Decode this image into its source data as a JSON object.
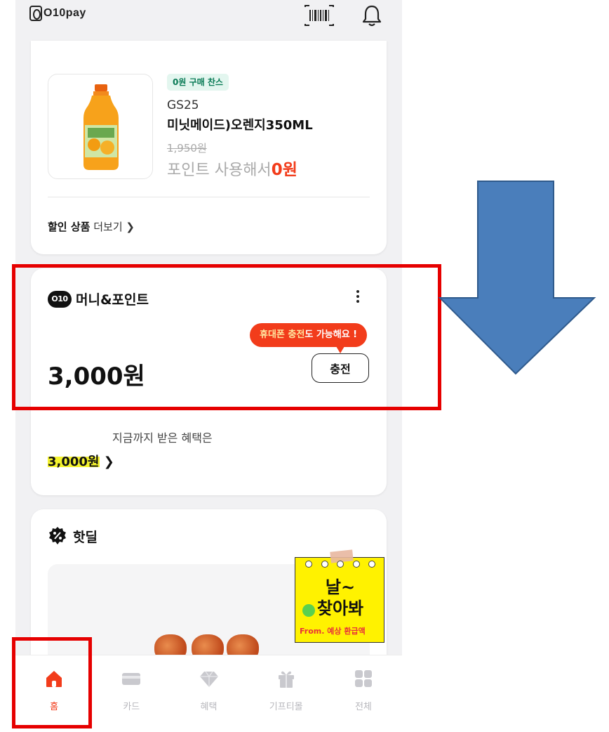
{
  "app": {
    "logo_text": "O10pay"
  },
  "header": {
    "barcode_icon": "barcode-icon",
    "bell_icon": "bell-icon"
  },
  "deal_card": {
    "badge": "0원 구매 찬스",
    "store": "GS25",
    "product_name": "미닛메이드)오렌지350ML",
    "original_price": "1,950원",
    "point_text": "포인트 사용해서",
    "point_price": "0원",
    "more_bold": "할인 상품",
    "more_rest": "더보기 ❯"
  },
  "money_card": {
    "logo": "O10",
    "title": "머니&포인트",
    "tooltip_highlight": "휴대폰 충전",
    "tooltip_rest": "도 가능해요 !",
    "amount": "3,000원",
    "charge_button": "충전",
    "benefit_label": "지금까지 받은 혜택은",
    "benefit_amount": "3,000원",
    "benefit_arrow": "❯"
  },
  "hot_deal": {
    "title": "핫딜",
    "sticker_line1": "날~",
    "sticker_line2": "찾아봐",
    "sticker_small": "From. 예상 환급액"
  },
  "bottom_nav": [
    {
      "label": "홈",
      "icon": "home-icon",
      "active": true
    },
    {
      "label": "카드",
      "icon": "card-icon",
      "active": false
    },
    {
      "label": "혜택",
      "icon": "diamond-icon",
      "active": false
    },
    {
      "label": "기프티몰",
      "icon": "gift-icon",
      "active": false
    },
    {
      "label": "전체",
      "icon": "grid-icon",
      "active": false
    }
  ],
  "colors": {
    "accent": "#f23c1b",
    "highlight": "#f4f32f",
    "annotation": "#e60000",
    "arrow": "#4a7ebb"
  }
}
